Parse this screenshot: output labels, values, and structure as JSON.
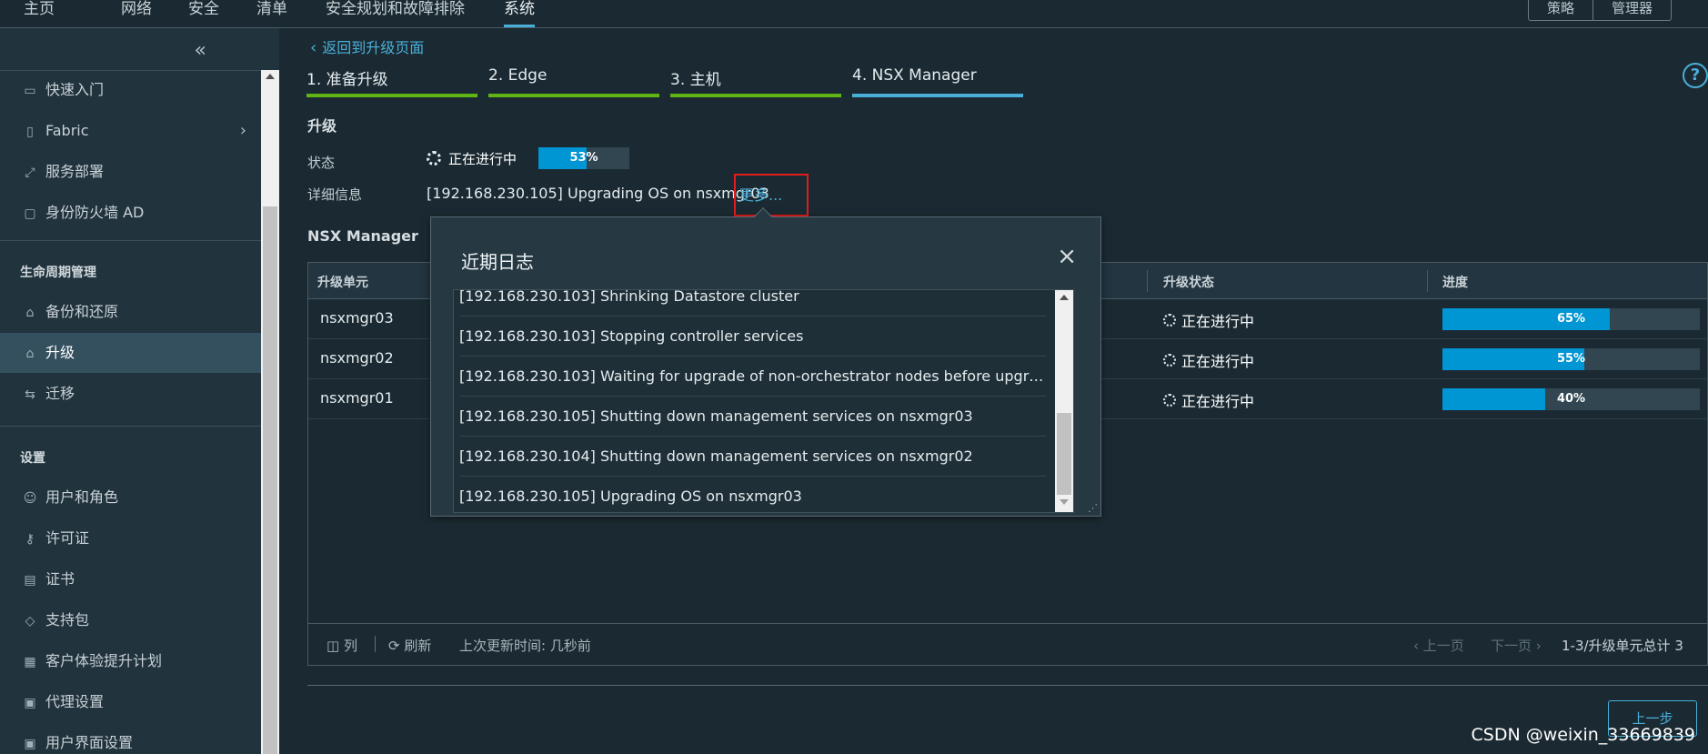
{
  "topnav": {
    "tabs": [
      {
        "label": "主页"
      },
      {
        "label": "网络"
      },
      {
        "label": "安全"
      },
      {
        "label": "清单"
      },
      {
        "label": "安全规划和故障排除"
      },
      {
        "label": "系统"
      }
    ],
    "active_tab": "系统",
    "right_buttons": [
      "策略",
      "管理器"
    ]
  },
  "sidebar": {
    "collapse_icon": "«",
    "items_top": [
      {
        "label": "快速入门",
        "icon": "laptop-icon"
      },
      {
        "label": "Fabric",
        "icon": "server-icon",
        "has_submenu": true
      },
      {
        "label": "服务部署",
        "icon": "deploy-icon"
      },
      {
        "label": "身份防火墙 AD",
        "icon": "folder-icon"
      }
    ],
    "section_lifecycle": "生命周期管理",
    "items_lifecycle": [
      {
        "label": "备份和还原",
        "icon": "backup-icon"
      },
      {
        "label": "升级",
        "icon": "upgrade-icon",
        "active": true
      },
      {
        "label": "迁移",
        "icon": "migrate-icon"
      }
    ],
    "section_settings": "设置",
    "items_settings": [
      {
        "label": "用户和角色",
        "icon": "users-icon"
      },
      {
        "label": "许可证",
        "icon": "key-icon"
      },
      {
        "label": "证书",
        "icon": "certificate-icon"
      },
      {
        "label": "支持包",
        "icon": "package-icon"
      },
      {
        "label": "客户体验提升计划",
        "icon": "ceip-icon"
      },
      {
        "label": "代理设置",
        "icon": "proxy-icon"
      },
      {
        "label": "用户界面设置",
        "icon": "ui-settings-icon"
      }
    ]
  },
  "main": {
    "back_link": "返回到升级页面",
    "steps": [
      {
        "label": "1. 准备升级",
        "state": "done"
      },
      {
        "label": "2. Edge",
        "state": "done"
      },
      {
        "label": "3. 主机",
        "state": "done"
      },
      {
        "label": "4. NSX Manager",
        "state": "current"
      }
    ],
    "upgrade_title": "升级",
    "status_label": "状态",
    "status_text": "正在进行中",
    "status_progress": 53,
    "status_progress_text": "53%",
    "detail_label": "详细信息",
    "detail_text": "[192.168.230.105] Upgrading OS on nsxmgr03",
    "more_link": "更多...",
    "nsx_manager_title": "NSX Manager",
    "grid": {
      "columns": [
        "升级单元",
        "升级状态",
        "进度"
      ],
      "rows": [
        {
          "unit": "nsxmgr03",
          "status": "正在进行中",
          "progress": 65,
          "progress_text": "65%"
        },
        {
          "unit": "nsxmgr02",
          "status": "正在进行中",
          "progress": 55,
          "progress_text": "55%"
        },
        {
          "unit": "nsxmgr01",
          "status": "正在进行中",
          "progress": 40,
          "progress_text": "40%"
        }
      ],
      "footer": {
        "columns_label": "列",
        "refresh_label": "刷新",
        "last_updated": "上次更新时间: 几秒前",
        "prev_page": "上一页",
        "next_page": "下一页",
        "total": "1-3/升级单元总计 3"
      }
    },
    "prev_button": "上一步"
  },
  "modal": {
    "title": "近期日志",
    "close_icon": "×",
    "logs": [
      "[192.168.230.103] Shrinking Datastore cluster",
      "[192.168.230.103] Stopping controller services",
      "[192.168.230.103] Waiting for upgrade of non-orchestrator nodes before upgra...",
      "[192.168.230.105] Shutting down management services on nsxmgr03",
      "[192.168.230.104] Shutting down management services on nsxmgr02",
      "[192.168.230.105] Upgrading OS on nsxmgr03"
    ]
  },
  "watermark": "CSDN @weixin_33669839",
  "colors": {
    "accent": "#49afd9",
    "progress_fill": "#0095d3",
    "step_done": "#60b515",
    "highlight_box": "#e21b1b"
  }
}
